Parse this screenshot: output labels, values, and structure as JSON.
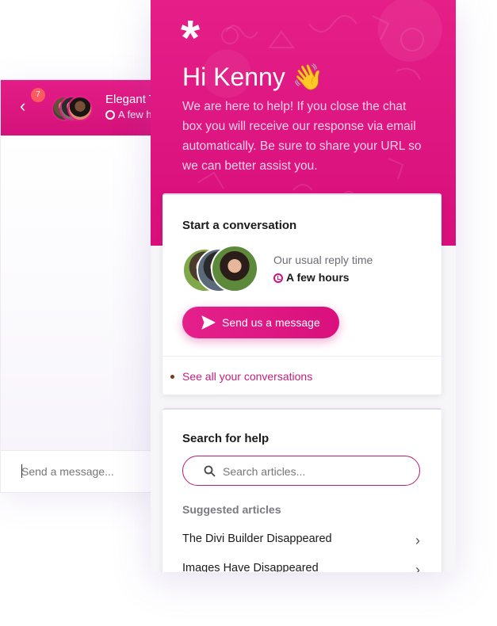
{
  "background_chat": {
    "unread_count": "7",
    "agent_name": "Elegant T",
    "reply_time": "A few h",
    "input_placeholder": "Send a message..."
  },
  "hero": {
    "logo": "*",
    "greeting": "Hi Kenny 👋",
    "message": "We are here to help! If you close the chat box you will receive our response via email automatically. Be sure to share your URL so we can better assist you."
  },
  "conversation_card": {
    "title": "Start a conversation",
    "reply_label": "Our usual reply time",
    "reply_value": "A few hours",
    "send_button": "Send us a message",
    "see_all_link": "See all your conversations"
  },
  "search_card": {
    "title": "Search for help",
    "search_placeholder": "Search articles...",
    "suggested_heading": "Suggested articles",
    "articles": [
      {
        "label": "The Divi Builder Disappeared"
      },
      {
        "label": "Images Have Disappeared"
      }
    ]
  },
  "colors": {
    "brand_pink": "#e41d87",
    "accent_text": "#c2207c"
  }
}
